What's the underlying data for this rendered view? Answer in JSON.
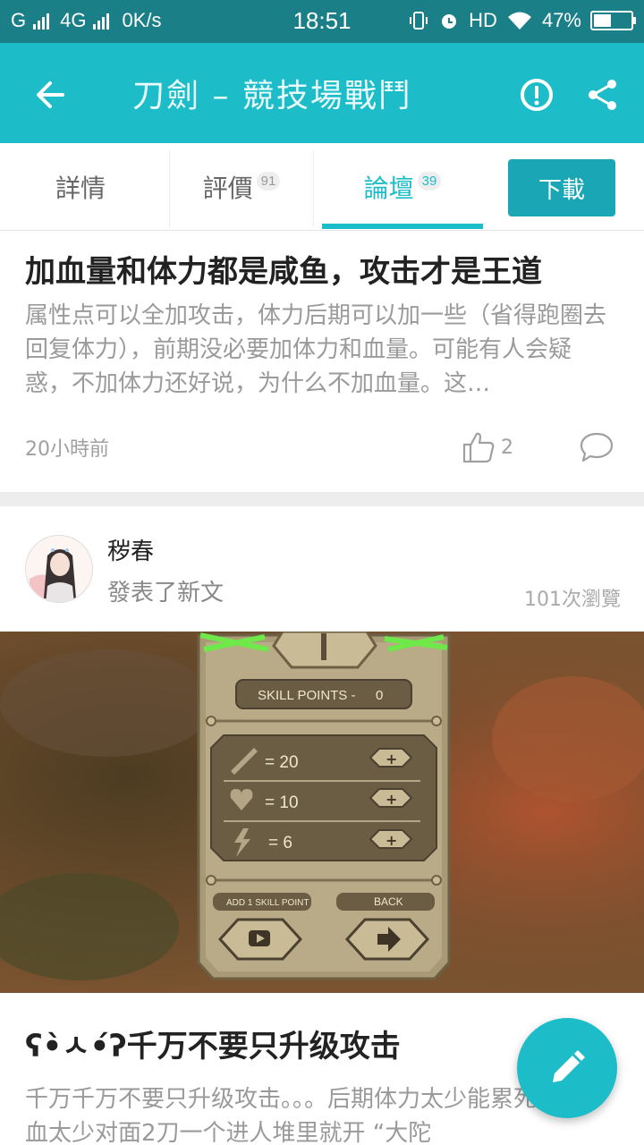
{
  "status_bar": {
    "network_1": "G",
    "network_2": "4G",
    "speed": "0K/s",
    "time": "18:51",
    "hd": "HD",
    "battery_text": "47%",
    "battery_level": 0.47
  },
  "appbar": {
    "title": "刀劍 – 競技場戰鬥"
  },
  "tabs": [
    {
      "label": "詳情",
      "badge": ""
    },
    {
      "label": "評價",
      "badge": "91"
    },
    {
      "label": "論壇",
      "badge": "39"
    }
  ],
  "download_label": "下載",
  "post1": {
    "title": "加血量和体力都是咸鱼，攻击才是王道",
    "body": "属性点可以全加攻击，体力后期可以加一些（省得跑圈去回复体力），前期没必要加体力和血量。可能有人会疑惑，不加体力还好说，为什么不加血量。这…",
    "time": "20小時前",
    "likes": "2"
  },
  "post2": {
    "author": "秽春",
    "action": "發表了新文",
    "views": "101次瀏覽",
    "title": "ʕ•̀ㅅ•́ʔ千万不要只升级攻击",
    "body": "千万千万不要只升级攻击。。。后期体力太少能累死你。。。血太少对面2刀一个进人堆里就开 “大陀"
  },
  "game_panel": {
    "skill_points_label": "SKILL POINTS  -",
    "skill_points_value": "0",
    "stats": [
      {
        "icon": "sword-icon",
        "value": "= 20"
      },
      {
        "icon": "heart-icon",
        "value": "= 10"
      },
      {
        "icon": "lightning-icon",
        "value": "= 6"
      }
    ],
    "add_skill_point_label": "ADD 1 SKILL POINT",
    "back_label": "BACK"
  },
  "colors": {
    "status_bar": "#1a7f86",
    "app_bar": "#1cbcc9",
    "accent": "#1cbcc9",
    "download_button": "#1aa6b4"
  }
}
